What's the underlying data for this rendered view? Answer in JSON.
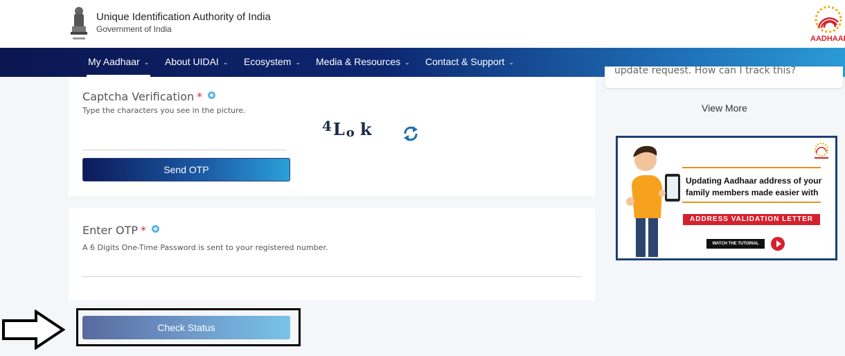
{
  "header": {
    "org_name": "Unique Identification Authority of India",
    "org_sub": "Government of India",
    "logo_text": "AADHAAR"
  },
  "nav": {
    "items": [
      {
        "label": "My Aadhaar",
        "active": true
      },
      {
        "label": "About UIDAI"
      },
      {
        "label": "Ecosystem"
      },
      {
        "label": "Media & Resources"
      },
      {
        "label": "Contact & Support"
      }
    ]
  },
  "captcha": {
    "title": "Captcha Verification",
    "required_mark": "*",
    "hint": "Type the characters you see in the picture.",
    "image_text": "4Lok",
    "send_otp_label": "Send OTP"
  },
  "otp": {
    "title": "Enter OTP",
    "required_mark": "*",
    "hint": "A 6 Digits One-Time Password is sent to your registered number."
  },
  "check_status_label": "Check Status",
  "sidebar": {
    "faq_text": "update request. How can I track this?",
    "view_more": "View More",
    "banner": {
      "line1": "Updating Aadhaar address of your",
      "line2": "family members made easier with",
      "tag": "ADDRESS VALIDATION LETTER",
      "cta": "WATCH THE TUTORIAL"
    }
  },
  "colors": {
    "nav_start": "#0b1651",
    "nav_end": "#2b9bd6",
    "required": "#d0312d",
    "banner_border": "#1d3f77",
    "tag_red": "#d6212d"
  }
}
